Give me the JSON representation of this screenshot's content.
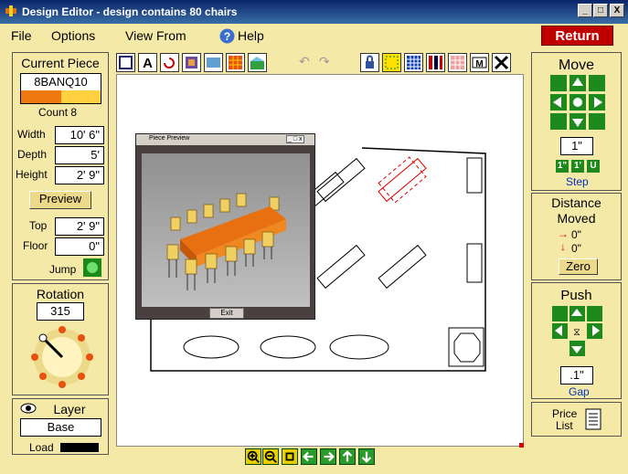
{
  "window": {
    "title": "Design Editor - design contains 80 chairs",
    "min": "_",
    "max": "□",
    "close": "X"
  },
  "menu": {
    "file": "File",
    "options": "Options",
    "view_from": "View From",
    "help": "Help",
    "return": "Return"
  },
  "current_piece": {
    "title": "Current Piece",
    "code": "8BANQ10",
    "count": "Count 8",
    "width_label": "Width",
    "width": "10' 6\"",
    "depth_label": "Depth",
    "depth": "5'",
    "height_label": "Height",
    "height": "2' 9\"",
    "preview": "Preview",
    "top_label": "Top",
    "top": "2' 9\"",
    "floor_label": "Floor",
    "floor": "0\"",
    "jump": "Jump"
  },
  "rotation": {
    "title": "Rotation",
    "value": "315"
  },
  "layer": {
    "title": "Layer",
    "value": "Base",
    "load": "Load"
  },
  "move": {
    "title": "Move",
    "step_value": "1\"",
    "step_label": "Step",
    "step_b1": "1\"",
    "step_b2": "1'",
    "step_b3": "U"
  },
  "distance": {
    "title1": "Distance",
    "title2": "Moved",
    "x": "0\"",
    "y": "0\"",
    "zero": "Zero"
  },
  "push": {
    "title": "Push",
    "gap_value": ".1\"",
    "gap_label": "Gap"
  },
  "price": {
    "l1": "Price",
    "l2": "List"
  },
  "preview_window": {
    "title": "Piece Preview",
    "exit": "Exit"
  }
}
